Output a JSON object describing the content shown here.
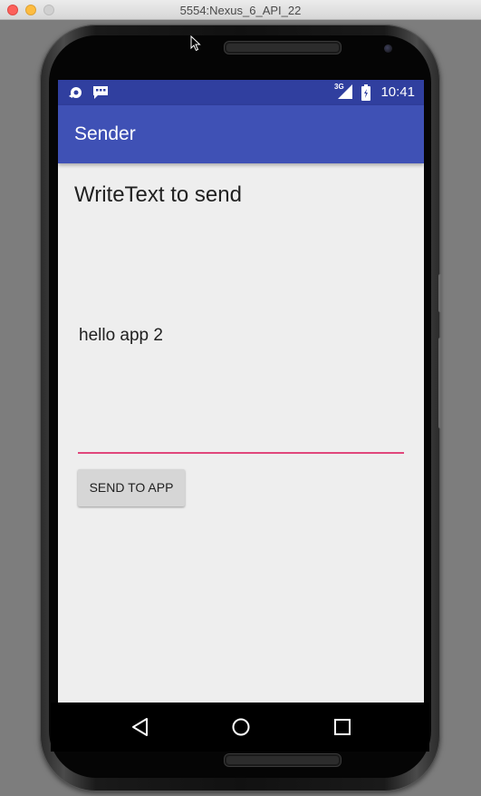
{
  "window": {
    "title": "5554:Nexus_6_API_22"
  },
  "status_bar": {
    "time": "10:41",
    "network_label": "3G",
    "icons": [
      "notification-icon",
      "message-icon",
      "signal-3g-icon",
      "battery-icon"
    ],
    "color": "#303f9f"
  },
  "app_bar": {
    "title": "Sender",
    "color": "#3f51b5"
  },
  "main": {
    "heading": "WriteText to send",
    "input_value": "hello app 2",
    "input_underline_color": "#e0477b",
    "send_button_label": "SEND TO APP"
  },
  "nav_bar": {
    "icons": [
      "back-icon",
      "home-icon",
      "recents-icon"
    ]
  }
}
